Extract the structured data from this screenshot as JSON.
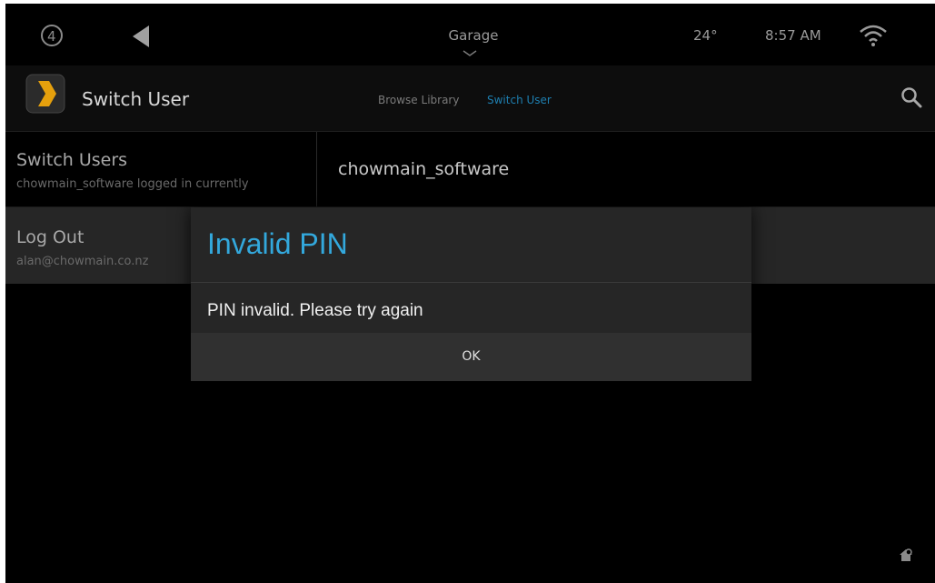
{
  "status_bar": {
    "logo_icon": "control4-logo-icon",
    "back_icon": "back-arrow-icon",
    "room": "Garage",
    "temperature": "24°",
    "time": "8:57 AM",
    "wifi_icon": "wifi-icon"
  },
  "action_bar": {
    "app_icon": "plex-logo-icon",
    "title": "Switch User",
    "tabs": [
      {
        "label": "Browse Library",
        "active": false
      },
      {
        "label": "Switch User",
        "active": true
      }
    ],
    "search_icon": "search-icon",
    "active_color": "#1e7fb0"
  },
  "list": {
    "switch_users": {
      "title": "Switch Users",
      "subtitle": "chowmain_software logged in currently",
      "value": "chowmain_software"
    },
    "logout": {
      "title": "Log Out",
      "subtitle": "alan@chowmain.co.nz"
    }
  },
  "dialog": {
    "title": "Invalid PIN",
    "message": "PIN invalid.  Please try again",
    "button": "OK",
    "title_color": "#33a8dc"
  },
  "corner_icon": "remote-settings-icon"
}
